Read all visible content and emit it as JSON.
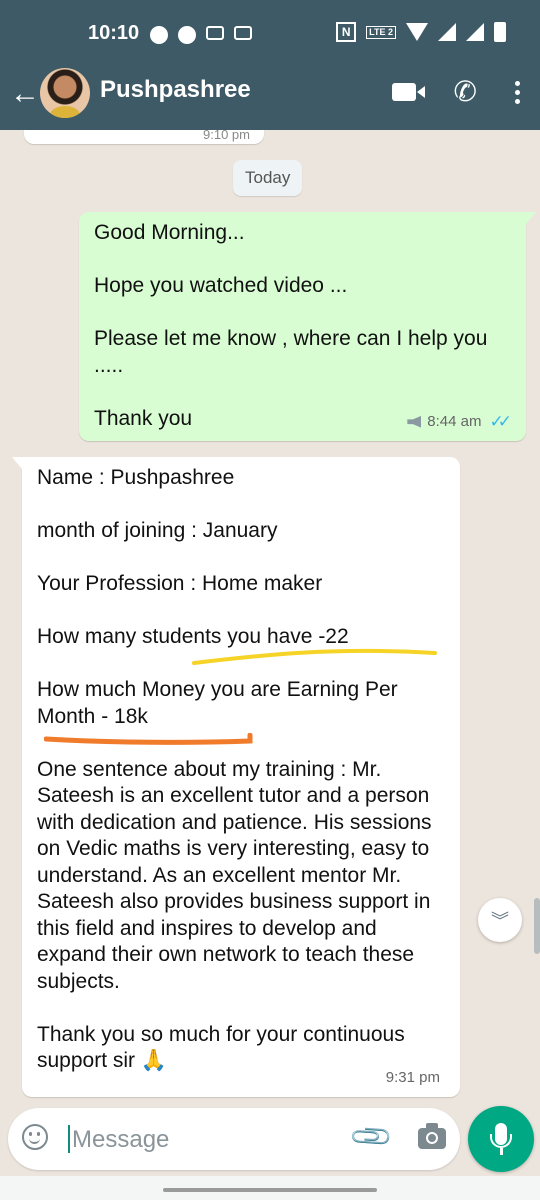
{
  "status_bar": {
    "time": "10:10",
    "network": "LTE 2",
    "nfc": "N"
  },
  "header": {
    "contact_name": "Pushpashree"
  },
  "chat": {
    "previous_time": "9:10 pm",
    "date_divider": "Today",
    "messages": [
      {
        "direction": "outgoing",
        "text": "Good Morning...\n\nHope you watched video ...\n\nPlease let me know , where can I help you .....\n\nThank you",
        "time": "8:44 am",
        "status": "read",
        "tick_glyph": "✓✓"
      },
      {
        "direction": "incoming",
        "text": "Name : Pushpashree\n\nmonth of joining : January\n\nYour Profession : Home maker\n\nHow many students you have -22\n\nHow much Money you are Earning Per Month - 18k\n\nOne sentence about my training : Mr. Sateesh is an excellent tutor and a person with dedication and patience. His sessions on Vedic maths is very interesting, easy to understand. As an excellent mentor Mr. Sateesh also provides business support in this field and inspires to develop and expand their own network to teach these subjects.\n\nThank you so much for your continuous support sir 🙏",
        "time": "9:31 pm"
      }
    ]
  },
  "composer": {
    "placeholder": "Message"
  },
  "colors": {
    "header": "#3d5a66",
    "outgoing_bubble": "#d9fdd3",
    "incoming_bubble": "#ffffff",
    "read_ticks": "#34b7f1",
    "mic_button": "#00a884",
    "highlight_yellow": "#f5d327",
    "highlight_orange": "#f07b2a"
  }
}
